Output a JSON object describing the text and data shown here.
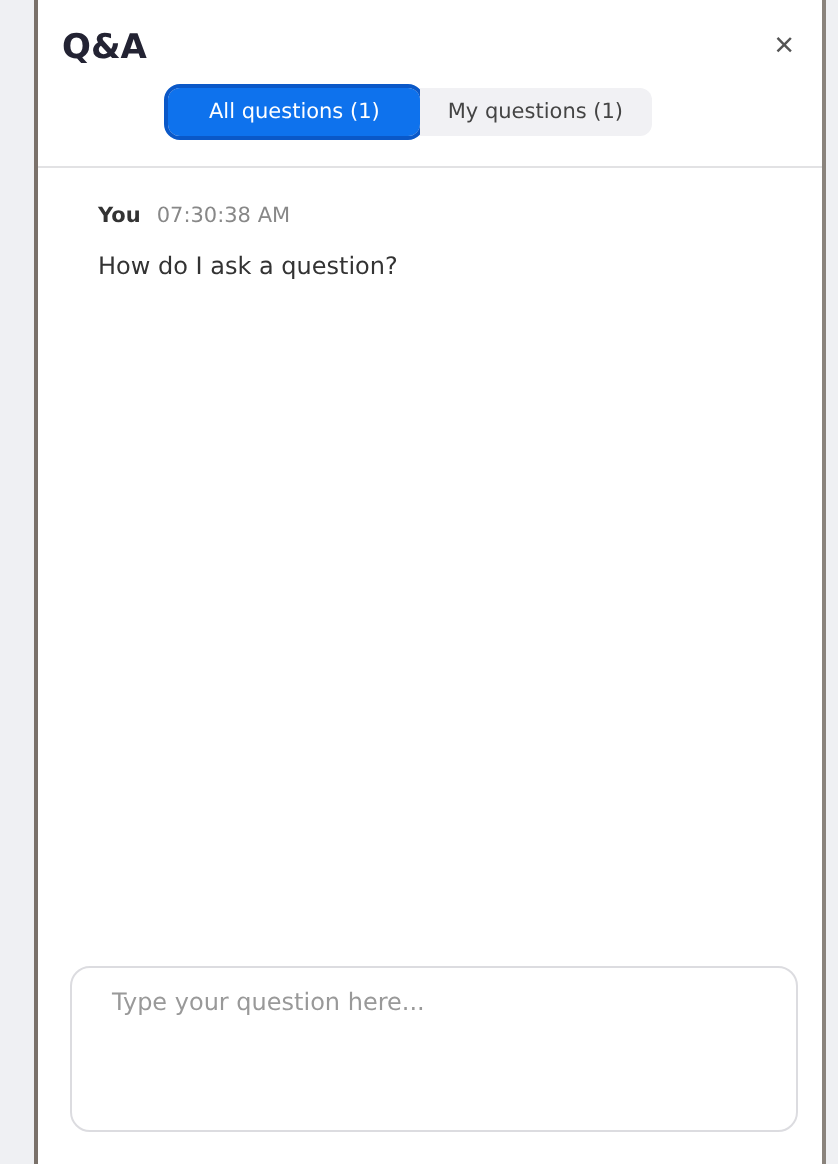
{
  "panel": {
    "title": "Q&A",
    "close": "×"
  },
  "tabs": [
    {
      "label": "All questions (1)",
      "selected": true
    },
    {
      "label": "My questions (1)",
      "selected": false
    }
  ],
  "questions": [
    {
      "author": "You",
      "time": "07:30:38 AM",
      "text": "How do I ask a question?"
    }
  ],
  "input": {
    "placeholder": "Type your question here..."
  }
}
